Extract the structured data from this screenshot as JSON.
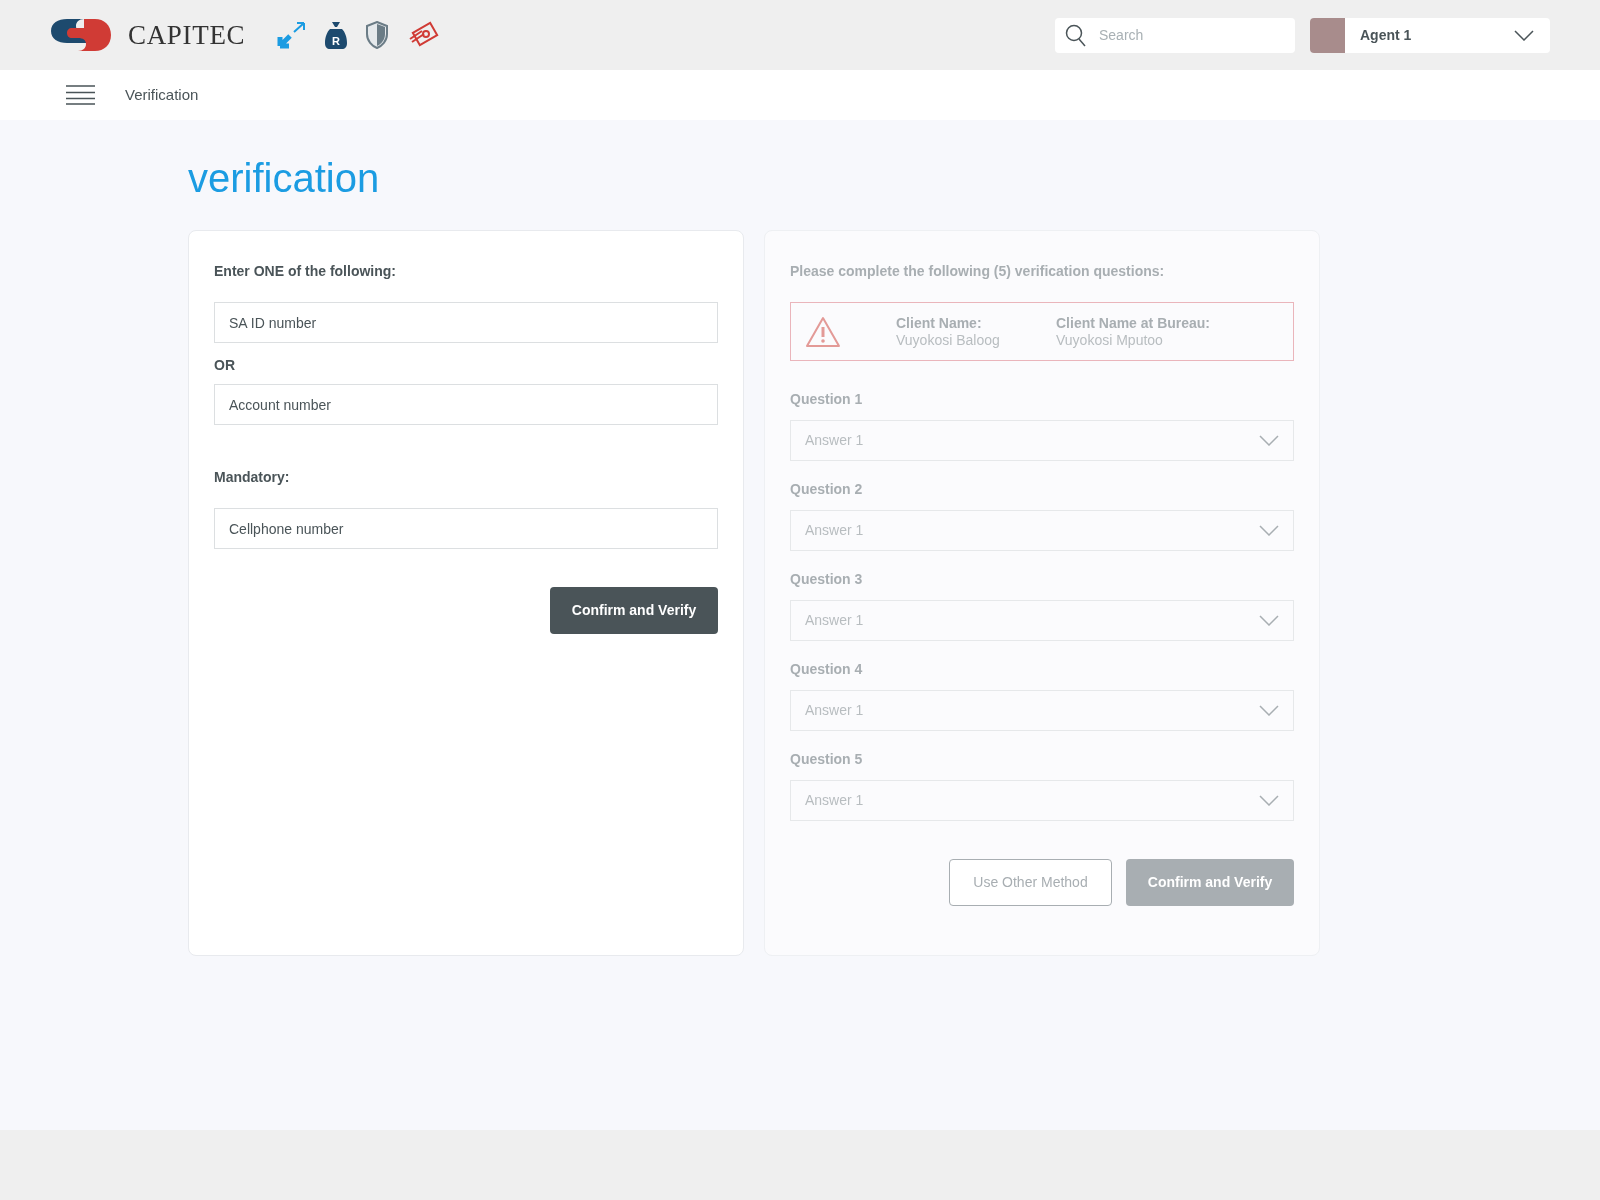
{
  "header": {
    "brand": "CAPITEC",
    "money_bag_label": "R",
    "search": {
      "placeholder": "Search"
    },
    "user": {
      "name": "Agent 1"
    }
  },
  "nav": {
    "title": "Verification"
  },
  "page_title": "verification",
  "identify_card": {
    "heading": "Enter ONE of the following:",
    "fields": [
      {
        "placeholder": "SA ID number"
      },
      {
        "placeholder": "Account number"
      }
    ],
    "separator": "OR",
    "mandatory_label": "Mandatory:",
    "mandatory_field": {
      "placeholder": "Cellphone number"
    },
    "button": "Confirm and Verify"
  },
  "questions_card": {
    "disabled": true,
    "heading": "Please complete the following (5) verification questions:",
    "alert": {
      "client_name_label": "Client Name:",
      "client_name": "Vuyokosi Baloog",
      "bureau_label": "Client Name at Bureau:",
      "bureau_name": "Vuyokosi Mputoo"
    },
    "questions": [
      {
        "label": "Question 1",
        "answer": "Answer 1"
      },
      {
        "label": "Question 2",
        "answer": "Answer 1"
      },
      {
        "label": "Question 3",
        "answer": "Answer 1"
      },
      {
        "label": "Question 4",
        "answer": "Answer 1"
      },
      {
        "label": "Question 5",
        "answer": "Answer 1"
      }
    ],
    "buttons": [
      {
        "label": "Use Other Method",
        "kind": "outline"
      },
      {
        "label": "Confirm and Verify",
        "kind": "primary"
      }
    ]
  }
}
